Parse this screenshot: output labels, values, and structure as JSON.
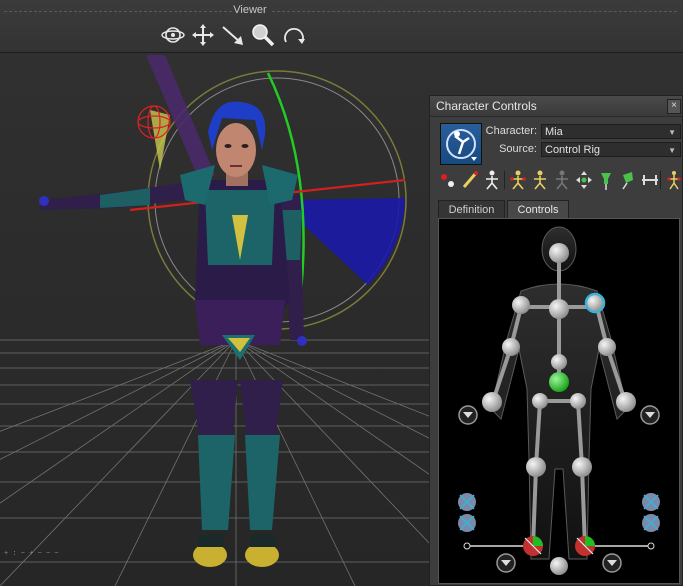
{
  "toolbar": {
    "title": "Viewer",
    "tools": [
      {
        "icon": "orbit-icon"
      },
      {
        "icon": "pan-icon"
      },
      {
        "icon": "dolly-icon"
      },
      {
        "icon": "zoom-icon"
      },
      {
        "icon": "roll-icon"
      }
    ]
  },
  "panel": {
    "title": "Character Controls",
    "close_icon": "close-icon",
    "character_label": "Character:",
    "character_value": "Mia",
    "source_label": "Source:",
    "source_value": "Control Rig",
    "tabs": [
      {
        "label": "Definition",
        "active": false
      },
      {
        "label": "Controls",
        "active": true
      }
    ],
    "tool_icons": [
      "full-body-icon",
      "body-part-icon",
      "pinning-icon",
      "stick-figure-icon",
      "ik-effector-icon",
      "fk-icon",
      "skeleton-icon",
      "transform-pivot-icon",
      "pin-translation-icon",
      "pin-rotation-icon",
      "release-pin-icon",
      "mirror-icon"
    ]
  },
  "colors": {
    "active_effector": "#1fbf1f",
    "selected_effector": "#37b5d8",
    "pinned_effector": "#c23030"
  }
}
